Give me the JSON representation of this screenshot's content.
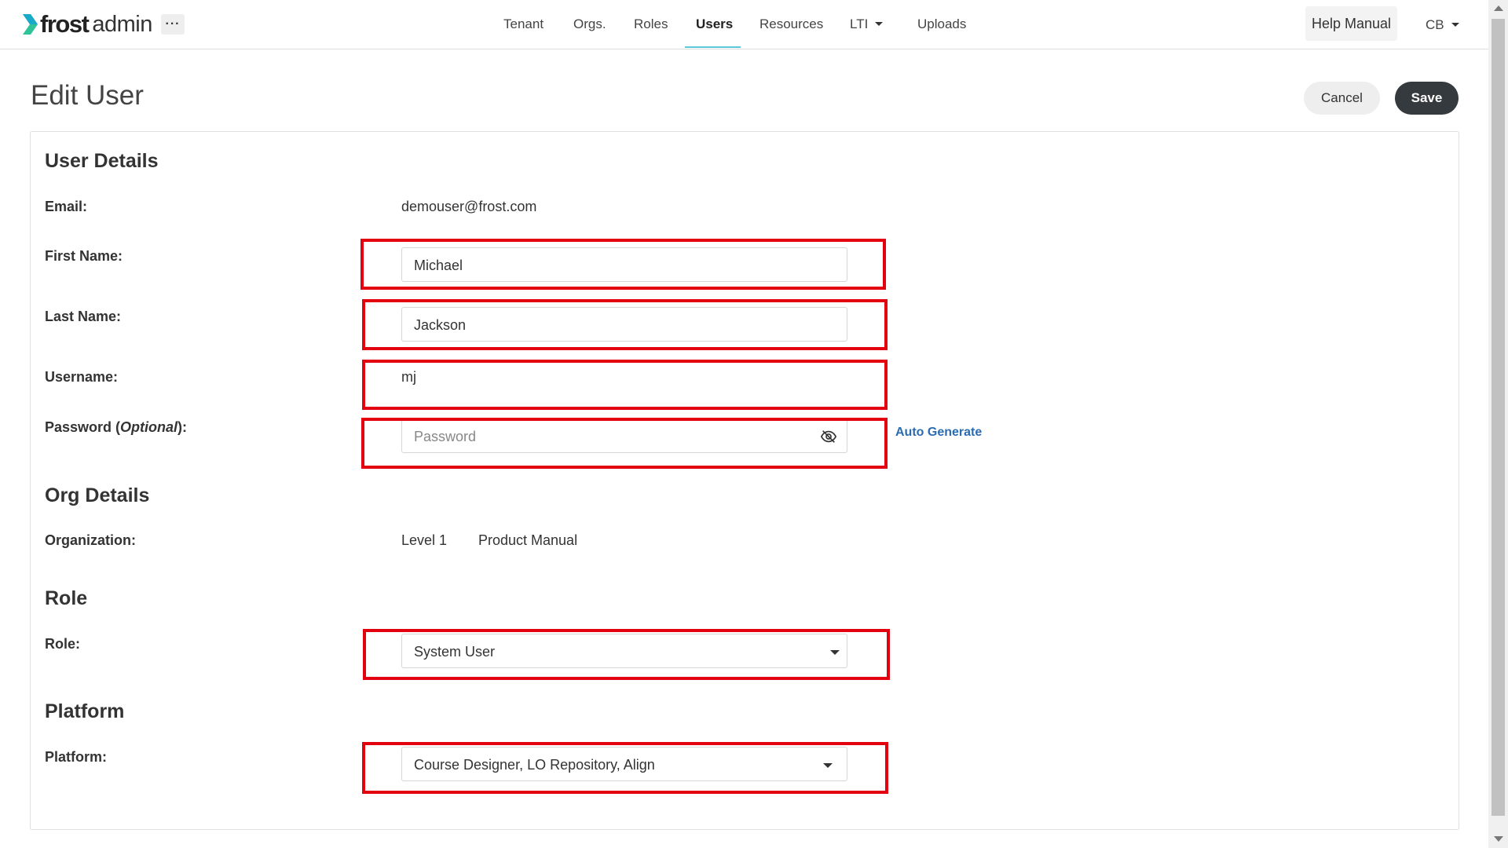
{
  "brand": {
    "name_bold": "frost",
    "name_light": "admin"
  },
  "header": {
    "more_label": "···",
    "nav": [
      "Tenant",
      "Orgs.",
      "Roles",
      "Users",
      "Resources",
      "LTI",
      "Uploads"
    ],
    "help_label": "Help Manual",
    "user_initials": "CB"
  },
  "page": {
    "title": "Edit User",
    "cancel_label": "Cancel",
    "save_label": "Save"
  },
  "user_details": {
    "heading": "User Details",
    "email_label": "Email:",
    "email_value": "demouser@frost.com",
    "first_name_label": "First Name:",
    "first_name_value": "Michael",
    "last_name_label": "Last Name:",
    "last_name_value": "Jackson",
    "username_label": "Username:",
    "username_value": "mj",
    "password_label_prefix": "Password (",
    "password_label_optional": "Optional",
    "password_label_suffix": "):",
    "password_placeholder": "Password",
    "auto_generate_label": "Auto Generate"
  },
  "org_details": {
    "heading": "Org Details",
    "organization_label": "Organization:",
    "level": "Level 1",
    "org_name": "Product Manual"
  },
  "role": {
    "heading": "Role",
    "label": "Role:",
    "value": "System User"
  },
  "platform": {
    "heading": "Platform",
    "label": "Platform:",
    "value": "Course Designer, LO Repository, Align"
  },
  "colors": {
    "accent_underline": "#5cc8d8",
    "highlight_box": "#e3000f",
    "save_button": "#343a3d",
    "link": "#2b6cb0",
    "logo_green": "#2fc39a"
  }
}
